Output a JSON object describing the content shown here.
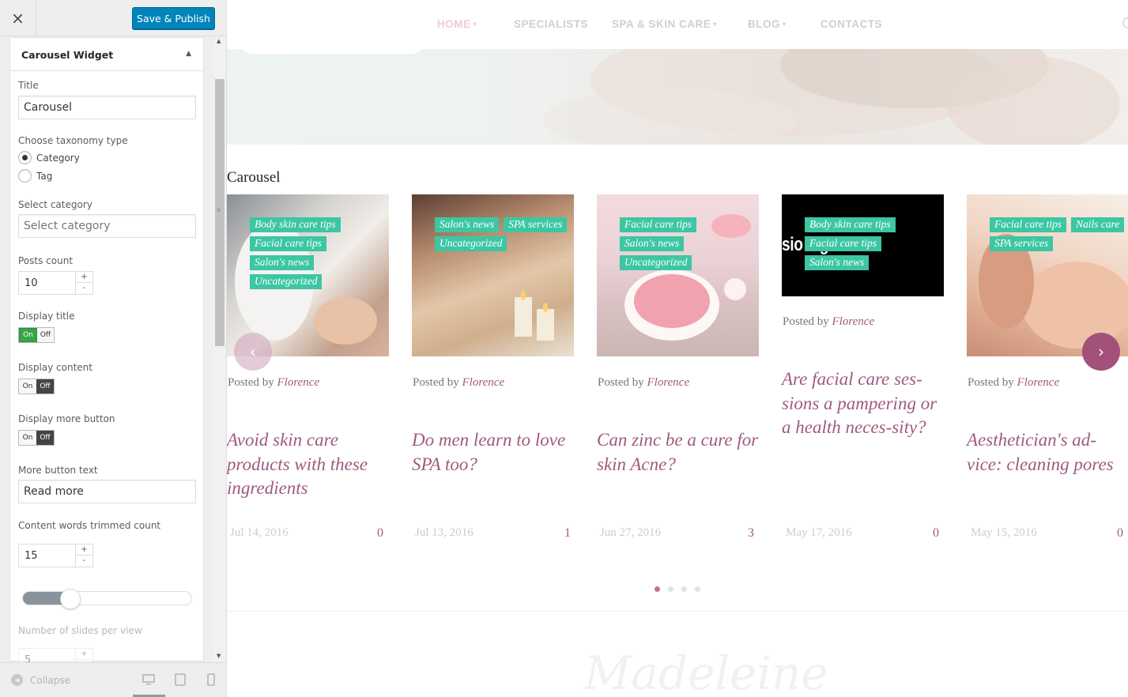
{
  "customizer": {
    "close_label": "×",
    "publish_label": "Save & Publish",
    "widget_title": "Carousel Widget",
    "fields": {
      "title_label": "Title",
      "title_value": "Carousel",
      "taxonomy_label": "Choose taxonomy type",
      "taxonomy_options": [
        "Category",
        "Tag"
      ],
      "taxonomy_selected": "Category",
      "category_label": "Select category",
      "category_placeholder": "Select category",
      "posts_count_label": "Posts count",
      "posts_count_value": "10",
      "display_title_label": "Display title",
      "display_title_state": "On",
      "display_content_label": "Display content",
      "display_content_state": "Off",
      "display_more_label": "Display more button",
      "display_more_state": "Off",
      "more_text_label": "More button text",
      "more_text_value": "Read more",
      "trim_label": "Content words trimmed count",
      "trim_value": "15",
      "slider_level": 0.28,
      "slides_per_view_label": "Number of slides per view",
      "slides_per_view_value": "5"
    },
    "toggle_on": "On",
    "toggle_off": "Off",
    "stepper_plus": "+",
    "stepper_minus": "-",
    "collapse_label": "Collapse",
    "devices": [
      "desktop-icon",
      "tablet-icon",
      "mobile-icon"
    ]
  },
  "site": {
    "nav": [
      {
        "label": "HOME",
        "dropdown": true,
        "active": true
      },
      {
        "label": "SPECIALISTS",
        "dropdown": false
      },
      {
        "label": "SPA & SKIN CARE",
        "dropdown": true
      },
      {
        "label": "BLOG",
        "dropdown": true
      },
      {
        "label": "CONTACTS",
        "dropdown": false
      }
    ],
    "section_title": "Carousel",
    "posted_by": "Posted by",
    "posts": [
      {
        "tags": [
          "Body skin care tips",
          "Facial care tips",
          "Salon's news",
          "Uncategorized"
        ],
        "author": "Florence",
        "title": "Avoid skin care products with these ingredients",
        "date": "Jul 14, 2016",
        "comments": "0"
      },
      {
        "tags": [
          "Salon's news",
          "SPA services",
          "Uncategorized"
        ],
        "author": "Florence",
        "title": "Do men learn to love SPA too?",
        "date": "Jul 13, 2016",
        "comments": "1"
      },
      {
        "tags": [
          "Facial care tips",
          "Salon's news",
          "Uncategorized"
        ],
        "author": "Florence",
        "title": "Can zinc be a cure for skin Acne?",
        "date": "Jun 27, 2016",
        "comments": "3"
      },
      {
        "tags": [
          "Body skin care tips",
          "Facial care tips",
          "Salon's news"
        ],
        "author": "Florence",
        "title": "Are facial care ses-sions a pampering or a health neces-sity?",
        "date": "May 17, 2016",
        "comments": "0",
        "image_text": "sio ing or a"
      },
      {
        "tags": [
          "Facial care tips",
          "Nails care",
          "SPA services"
        ],
        "author": "Florence",
        "title": "Aesthetician's ad-vice: cleaning pores",
        "date": "May 15, 2016",
        "comments": "0"
      }
    ],
    "carousel_pages": 4,
    "carousel_active_page": 1,
    "prev_icon": "‹",
    "next_icon": "›",
    "footer_logo": "Madeleine",
    "colors": {
      "accent": "#a05a80",
      "tag": "#3cc6a3",
      "publish": "#0085ba"
    }
  }
}
